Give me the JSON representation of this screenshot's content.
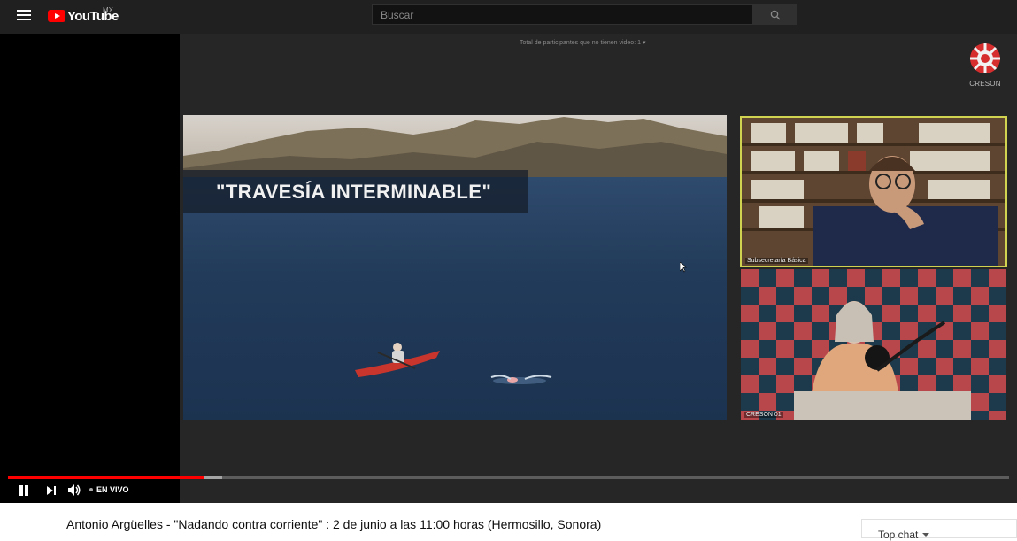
{
  "header": {
    "logo_text": "YouTube",
    "country": "MX",
    "search_placeholder": "Buscar"
  },
  "video": {
    "participants_text": "Total de participantes que no tienen video: 1",
    "org_logo_label": "CRESON",
    "slide_title": "\"TRAVESÍA INTERMINABLE\"",
    "cam1_label": "Subsecretaría Básica",
    "cam2_label": "CRESON 01",
    "progress_played": 0.196,
    "progress_loaded": 0.214
  },
  "controls": {
    "live_label": "EN VIVO"
  },
  "meta": {
    "title": "Antonio Argüelles - \"Nadando contra corriente\" : 2 de junio a las 11:00 horas (Hermosillo, Sonora)",
    "chat_mode": "Top chat"
  },
  "colors": {
    "brand": "#ff0000",
    "topbar": "#202020",
    "speaker_highlight": "#cfd34f"
  }
}
